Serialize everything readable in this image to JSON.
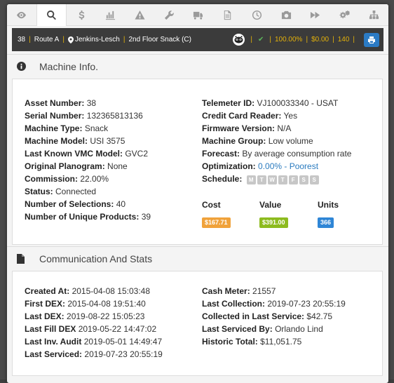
{
  "colors": {
    "cost_badge": "#f0a23b",
    "value_badge": "#8dbb1f",
    "units_badge": "#2f86d6",
    "accent_yellow": "#e3b10a"
  },
  "tabs": [
    {
      "icon": "eye-icon"
    },
    {
      "icon": "search-icon"
    },
    {
      "icon": "dollar-icon"
    },
    {
      "icon": "bar-chart-icon"
    },
    {
      "icon": "warning-icon"
    },
    {
      "icon": "wrench-icon"
    },
    {
      "icon": "truck-icon"
    },
    {
      "icon": "document-icon"
    },
    {
      "icon": "clock-icon"
    },
    {
      "icon": "camera-icon"
    },
    {
      "icon": "fast-forward-icon"
    },
    {
      "icon": "gears-icon"
    },
    {
      "icon": "sitemap-icon"
    }
  ],
  "route_bar": {
    "number": "38",
    "route": "Route A",
    "location": "Jenkins-Lesch",
    "machine": "2nd Floor Snack (C)",
    "check": "✔",
    "percent": "100.00%",
    "amount": "$0.00",
    "count": "140"
  },
  "machine_info": {
    "title": "Machine Info.",
    "left": [
      {
        "label": "Asset Number:",
        "value": "38"
      },
      {
        "label": "Serial Number:",
        "value": "132365813136"
      },
      {
        "label": "Machine Type:",
        "value": "Snack"
      },
      {
        "label": "Machine Model:",
        "value": "USI 3575"
      },
      {
        "label": "Last Known VMC Model:",
        "value": "GVC2"
      },
      {
        "label": "Original Planogram:",
        "value": "None"
      },
      {
        "label": "Commission:",
        "value": "22.00%"
      },
      {
        "label": "Status:",
        "value": "Connected"
      },
      {
        "label": "Number of Selections:",
        "value": "40"
      },
      {
        "label": "Number of Unique Products:",
        "value": "39"
      }
    ],
    "right": [
      {
        "label": "Telemeter ID:",
        "value": "VJ100033340 - USAT"
      },
      {
        "label": "Credit Card Reader:",
        "value": "Yes"
      },
      {
        "label": "Firmware Version:",
        "value": "N/A"
      },
      {
        "label": "Machine Group:",
        "value": "Low volume"
      },
      {
        "label": "Forecast:",
        "value": "By average consumption rate"
      }
    ],
    "optimization_label": "Optimization:",
    "optimization_value": "0.00% - Poorest",
    "schedule_label": "Schedule:",
    "schedule_days": [
      "M",
      "T",
      "W",
      "T",
      "F",
      "S",
      "S"
    ],
    "metrics": [
      {
        "label": "Cost",
        "value": "$167.71"
      },
      {
        "label": "Value",
        "value": "$391.00"
      },
      {
        "label": "Units",
        "value": "366"
      }
    ]
  },
  "communication": {
    "title": "Communication And Stats",
    "left": [
      {
        "label": "Created At:",
        "value": "2015-04-08 15:03:48"
      },
      {
        "label": "First DEX:",
        "value": "2015-04-08 19:51:40"
      },
      {
        "label": "Last DEX:",
        "value": "2019-08-22 15:05:23"
      },
      {
        "label": "Last Fill DEX",
        "value": "2019-05-22 14:47:02"
      },
      {
        "label": "Last Inv. Audit",
        "value": "2019-05-01 14:49:47"
      },
      {
        "label": "Last Serviced:",
        "value": "2019-07-23 20:55:19"
      }
    ],
    "right": [
      {
        "label": "Cash Meter:",
        "value": "21557"
      },
      {
        "label": "Last Collection:",
        "value": "2019-07-23 20:55:19"
      },
      {
        "label": "Collected in Last Service:",
        "value": "$42.75"
      },
      {
        "label": "Last Serviced By:",
        "value": "Orlando Lind"
      },
      {
        "label": "Historic Total:",
        "value": "$11,051.75"
      }
    ]
  }
}
